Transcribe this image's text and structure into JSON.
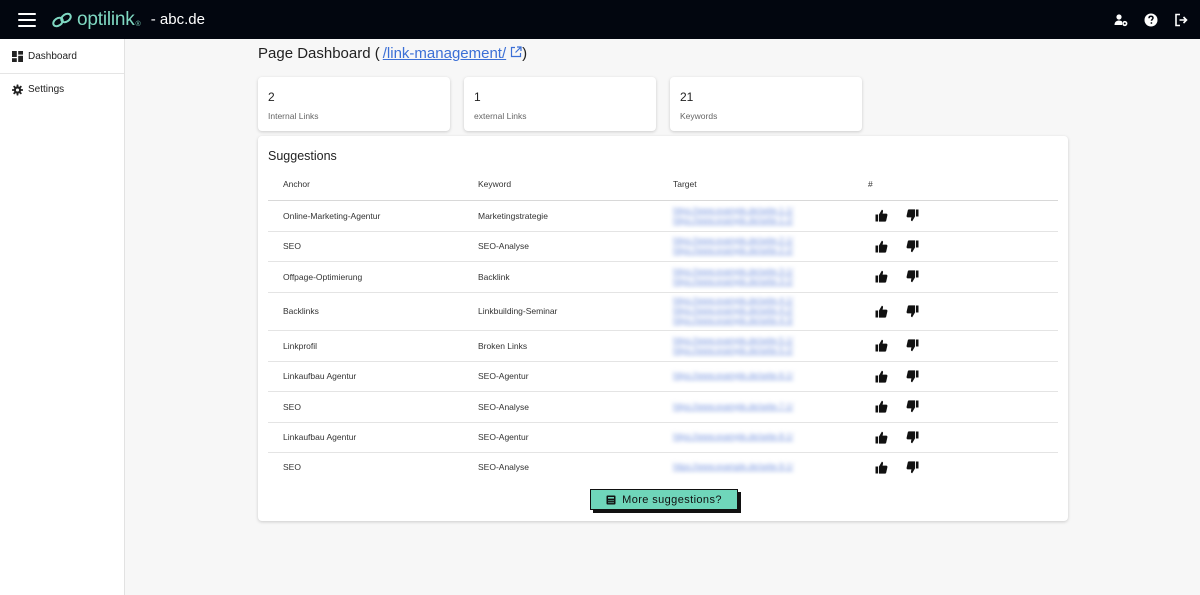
{
  "appbar": {
    "logo_text": "optilink",
    "logo_suffix": "®",
    "domain": "- abc.de",
    "icons": [
      "menu-icon",
      "link-logo-icon",
      "user-settings-icon",
      "help-icon",
      "logout-icon"
    ]
  },
  "sidebar": {
    "items": [
      {
        "label": "Dashboard",
        "icon": "dashboard-icon"
      },
      {
        "label": "Settings",
        "icon": "gear-icon"
      }
    ]
  },
  "page": {
    "title_prefix": "Page Dashboard (",
    "title_link": "/link-management/",
    "title_suffix": ")"
  },
  "stats": [
    {
      "value": "2",
      "label": "Internal Links"
    },
    {
      "value": "1",
      "label": "external Links"
    },
    {
      "value": "21",
      "label": "Keywords"
    }
  ],
  "suggestions": {
    "title": "Suggestions",
    "columns": [
      "Anchor",
      "Keyword",
      "Target",
      "#"
    ],
    "rows": [
      {
        "anchor": "Online-Marketing-Agentur",
        "keyword": "Marketingstrategie"
      },
      {
        "anchor": "SEO",
        "keyword": "SEO-Analyse"
      },
      {
        "anchor": "Offpage-Optimierung",
        "keyword": "Backlink"
      },
      {
        "anchor": "Backlinks",
        "keyword": "Linkbuilding-Seminar"
      },
      {
        "anchor": "Linkprofil",
        "keyword": "Broken Links"
      },
      {
        "anchor": "Linkaufbau Agentur",
        "keyword": "SEO-Agentur"
      },
      {
        "anchor": "SEO",
        "keyword": "SEO-Analyse"
      },
      {
        "anchor": "Linkaufbau Agentur",
        "keyword": "SEO-Agentur"
      },
      {
        "anchor": "SEO",
        "keyword": "SEO-Analyse"
      }
    ],
    "more_label": "More suggestions?"
  },
  "colors": {
    "appbar_bg": "#02060f",
    "brand": "#7fd8c2",
    "button_bg": "#6fd6ba",
    "link": "#3b6fd6"
  }
}
